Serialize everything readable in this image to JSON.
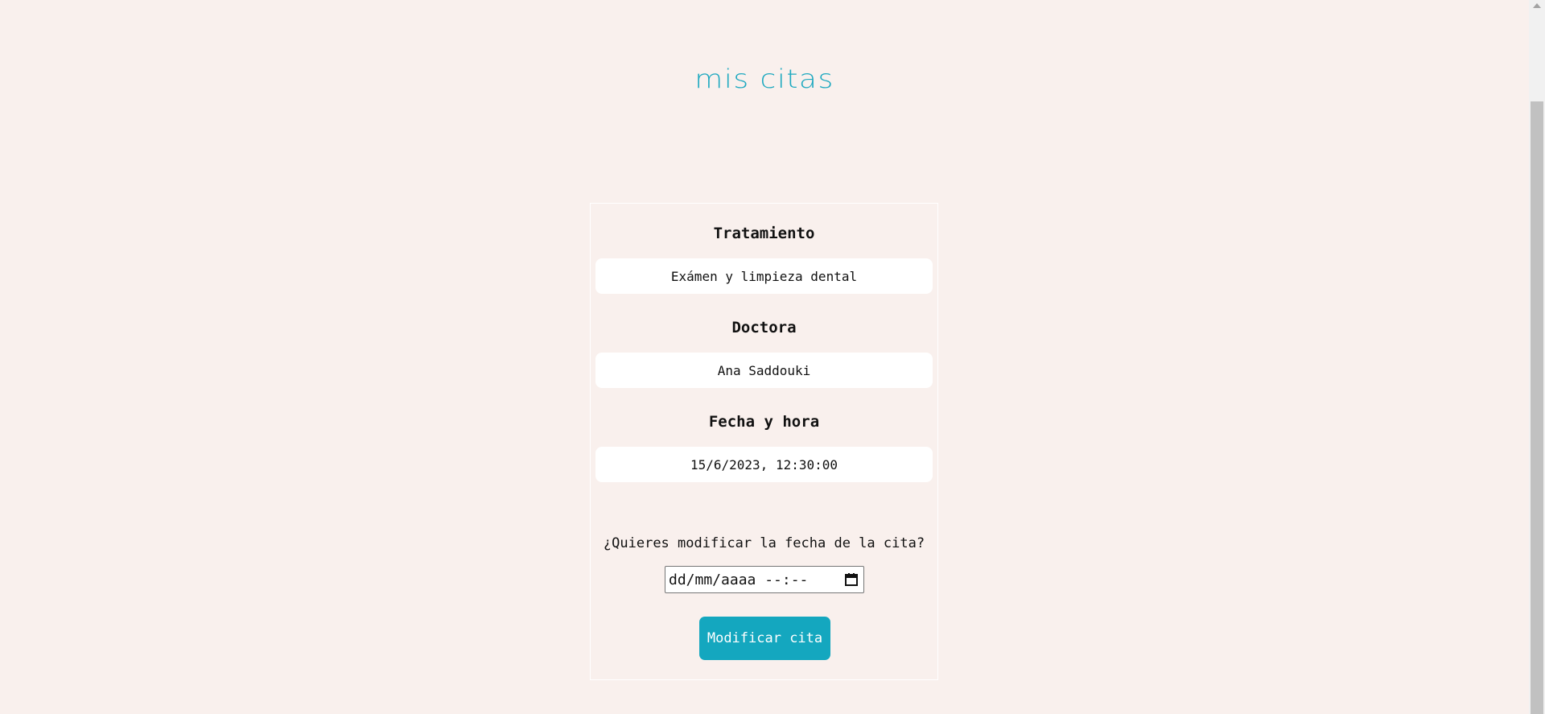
{
  "page": {
    "title": "mis citas"
  },
  "appointment": {
    "treatment_label": "Tratamiento",
    "treatment_value": "Exámen y limpieza dental",
    "doctor_label": "Doctora",
    "doctor_value": "Ana Saddouki",
    "datetime_label": "Fecha y hora",
    "datetime_value": "15/6/2023, 12:30:00"
  },
  "modify": {
    "question": "¿Quieres modificar la fecha de la cita?",
    "date_placeholder": "dd/mm/aaaa --:--",
    "button_label": "Modificar cita"
  },
  "icons": {
    "calendar": "calendar-icon"
  },
  "colors": {
    "background": "#f9f0ed",
    "accent": "#14a7bf",
    "title": "#1fa9c0"
  }
}
